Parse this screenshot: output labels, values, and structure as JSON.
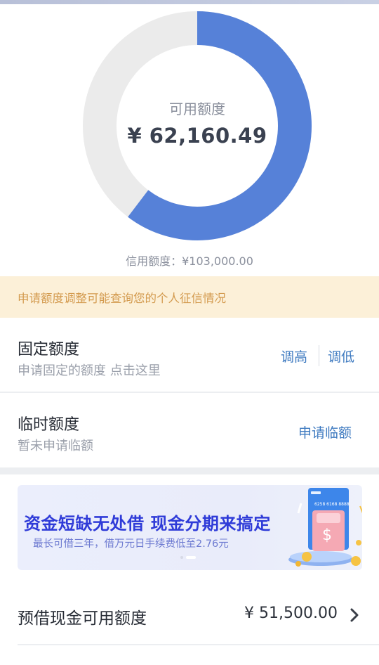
{
  "ring": {
    "label": "可用额度",
    "value": "¥ 62,160.49",
    "available_fraction": 0.6035,
    "used_color": "#ebebeb",
    "available_color": "#5681d8"
  },
  "credit_line": "信用额度：¥103,000.00",
  "notice": "申请额度调整可能查询您的个人征信情况",
  "fixed_limit": {
    "title": "固定额度",
    "subtitle": "申请固定的额度 点击这里",
    "raise_label": "调高",
    "lower_label": "调低"
  },
  "temp_limit": {
    "title": "临时额度",
    "subtitle": "暂未申请临额",
    "apply_label": "申请临额"
  },
  "banner": {
    "title": "资金短缺无处借 现金分期来搞定",
    "subtitle": "最长可借三年，借万元日手续费低至2.76元",
    "card_text": "6258 6168 8888",
    "page_index": 2,
    "page_count": 2
  },
  "cash_advance": {
    "title": "预借现金可用额度",
    "amount": "¥ 51,500.00"
  }
}
